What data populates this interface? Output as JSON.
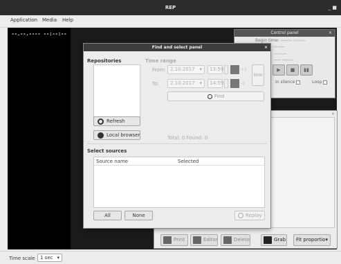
{
  "app": {
    "title": "REP",
    "window_controls": "_ ■"
  },
  "menu": {
    "items": [
      "Application",
      "Media",
      "Help"
    ]
  },
  "left_panel": {
    "clock": "--.--.---- --:--:--"
  },
  "status_bar": {
    "time_scale_label": "Time scale",
    "time_scale_value": "1 sec",
    "time_scale_arrow": "▾"
  },
  "control_panel": {
    "title": "Control panel",
    "close": "×",
    "begin_time": "Begin time: --:--:--  --:--:--",
    "row2": "-- --:--:--  --:--:--",
    "row3": "----  --:--:--",
    "row4": "--.--.--",
    "silence_label": "In silence",
    "loop_label": "Loop"
  },
  "panel2": {
    "close": "×",
    "buttons": {
      "print": "Print",
      "editor": "Editor",
      "delete": "Delete",
      "grab": "Grab",
      "fit": "Fit proportio"
    },
    "fit_arrow": "▾"
  },
  "find_dialog": {
    "title": "Find and select panel",
    "close": "×",
    "repositories_label": "Repositories",
    "refresh_label": "Refresh",
    "local_browser_label": "Local browser",
    "time_range_label": "Time range",
    "from_label": "From:",
    "to_label": "To:",
    "from_date": "2.10.2017",
    "to_date": "2.10.2017",
    "date_arrow": "▾",
    "from_time": "13:59",
    "to_time": "14:59",
    "plus1": "+1",
    "minus1": "-1",
    "now_label": "Now",
    "find_label": "Find",
    "total_text": "Total: 0 Found: 0",
    "select_sources_label": "Select sources",
    "col_source_name": "Source name",
    "col_selected": "Selected",
    "all_label": "All",
    "none_label": "None",
    "replay_label": "Replay"
  },
  "colors": {
    "titlebar": "#2b2b2b",
    "canvas": "#1a1a1a",
    "dialog_bg": "#ececec"
  }
}
